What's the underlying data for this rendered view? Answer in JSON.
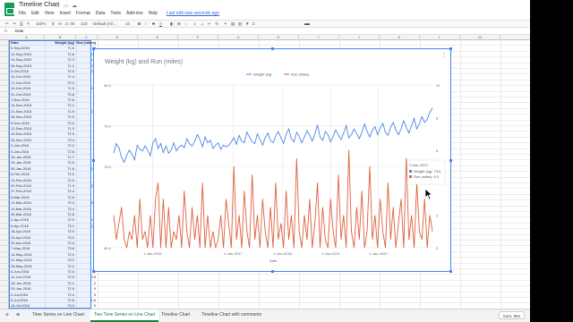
{
  "app": {
    "doc_title": "Timeline Chart",
    "menu": [
      "File",
      "Edit",
      "View",
      "Insert",
      "Format",
      "Data",
      "Tools",
      "Add-ons",
      "Help"
    ],
    "last_edit": "Last edit was seconds ago",
    "fx_label": "fx",
    "fx_value": "Date"
  },
  "toolbar": {
    "zoom": "100%",
    "currency": "$",
    "percent": "%",
    "decimals": ".0 .00",
    "numfmt": "123",
    "font": "Default (Ari...",
    "font_size": "10",
    "bold": "B",
    "italic": "I",
    "strike": "S",
    "text_color": "A"
  },
  "columns": [
    "A",
    "B",
    "C",
    "D",
    "E",
    "F",
    "G",
    "H",
    "I",
    "J",
    "K",
    "L",
    "M"
  ],
  "table": {
    "headers": [
      "Date",
      "Weight (kg)",
      "Run (miles)"
    ],
    "rows": [
      [
        "5-Sep-2015",
        "71.6",
        "2"
      ],
      [
        "12-Sep-2015",
        "72.8",
        "0.5"
      ],
      [
        "19-Sep-2015",
        "72.3",
        "1.5"
      ],
      [
        "26-Sep-2015",
        "71.1",
        "2.5"
      ],
      [
        "3-Oct-2015",
        "70.5",
        "0.5"
      ],
      [
        "10-Oct-2015",
        "71.4",
        "0"
      ],
      [
        "17-Oct-2015",
        "72.0",
        "1"
      ],
      [
        "24-Oct-2015",
        "71.5",
        "0.5"
      ],
      [
        "31-Oct-2015",
        "70.8",
        "2"
      ],
      [
        "7-Nov-2015",
        "72.6",
        "0"
      ],
      [
        "14-Nov-2015",
        "72.1",
        "3"
      ],
      [
        "21-Nov-2015",
        "71.9",
        "0.5"
      ],
      [
        "28-Nov-2015",
        "72.5",
        "1"
      ],
      [
        "5-Dec-2015",
        "72.0",
        "0"
      ],
      [
        "12-Dec-2015",
        "71.3",
        "2"
      ],
      [
        "19-Dec-2015",
        "72.9",
        "0"
      ],
      [
        "26-Dec-2015",
        "73.4",
        "3"
      ],
      [
        "2-Jan-2016",
        "72.2",
        "4"
      ],
      [
        "9-Jan-2016",
        "72.8",
        "0"
      ],
      [
        "16-Jan-2016",
        "71.7",
        "3"
      ],
      [
        "23-Jan-2016",
        "72.5",
        "0"
      ],
      [
        "30-Jan-2016",
        "71.6",
        "2.5"
      ],
      [
        "6-Feb-2016",
        "72.0",
        "0"
      ],
      [
        "13-Feb-2016",
        "72.9",
        "1"
      ],
      [
        "20-Feb-2016",
        "71.9",
        "0.5"
      ],
      [
        "27-Feb-2016",
        "72.4",
        "2"
      ],
      [
        "5-Mar-2016",
        "72.6",
        "0"
      ],
      [
        "12-Mar-2016",
        "72.3",
        "3.5"
      ],
      [
        "19-Mar-2016",
        "73.4",
        "1"
      ],
      [
        "26-Mar-2016",
        "72.8",
        "0"
      ],
      [
        "2-Apr-2016",
        "72.5",
        "2.5"
      ],
      [
        "9-Apr-2016",
        "73.1",
        "0.5"
      ],
      [
        "16-Apr-2016",
        "73.9",
        "2"
      ],
      [
        "23-Apr-2016",
        "73.3",
        "0"
      ],
      [
        "30-Apr-2016",
        "72.4",
        "4"
      ],
      [
        "7-May-2016",
        "73.6",
        "0"
      ],
      [
        "14-May-2016",
        "72.9",
        "2"
      ],
      [
        "21-May-2016",
        "73.2",
        "0"
      ],
      [
        "28-May-2016",
        "72.2",
        "1"
      ],
      [
        "4-Jun-2016",
        "72.6",
        "0"
      ],
      [
        "11-Jun-2016",
        "72.9",
        "0.5"
      ],
      [
        "18-Jun-2016",
        "72.1",
        "2"
      ],
      [
        "25-Jun-2016",
        "72.6",
        "0"
      ],
      [
        "2-Jul-2016",
        "72.4",
        "3"
      ],
      [
        "9-Jul-2016",
        "72.6",
        "1.5"
      ],
      [
        "16-Jul-2016",
        "73.0",
        "0"
      ]
    ]
  },
  "chart": {
    "title": "Weight (kg) and Run (miles)",
    "menu_icon": "kebab-menu-icon",
    "tooltip": {
      "date": "3-Mar-2020",
      "weight_label": "Weight (kg):",
      "weight_value": "75.6",
      "run_label": "Run (miles):",
      "run_value": "0.5"
    }
  },
  "chart_data": {
    "type": "line",
    "title": "Weight (kg) and Run (miles)",
    "xlabel": "Date",
    "ylabel": "",
    "legend_position": "top",
    "grid": true,
    "x_ticks": [
      "1-Jan-2016",
      "1-Jan-2017",
      "1-Jan-2018",
      "1-Jan-2019",
      "1-Jan-2020"
    ],
    "x_range": [
      "5-Sep-2015",
      "1-Sep-2020"
    ],
    "y_left": {
      "ticks": [
        "60.0",
        "70.0",
        "75.0",
        "80.0"
      ],
      "range": [
        60,
        80
      ]
    },
    "y_right": {
      "ticks": [
        "0",
        "2",
        "4",
        "6",
        "8",
        "10"
      ],
      "range": [
        0,
        10
      ]
    },
    "colors": {
      "weight": "#4a86e8",
      "run": "#e06040",
      "selection": "#4285f4",
      "accent": "#188038"
    },
    "series": [
      {
        "name": "Weight (kg)",
        "axis": "left",
        "values": [
          71.6,
          72.8,
          72.3,
          71.1,
          70.5,
          71.4,
          72.0,
          71.5,
          70.8,
          72.6,
          72.1,
          71.9,
          72.5,
          72.0,
          71.3,
          72.9,
          73.4,
          72.2,
          72.8,
          71.7,
          72.5,
          71.6,
          72.0,
          72.9,
          71.9,
          72.4,
          72.6,
          72.3,
          73.4,
          72.8,
          72.5,
          73.1,
          73.9,
          73.3,
          72.4,
          73.6,
          72.9,
          73.2,
          72.2,
          72.6,
          72.9,
          72.1,
          72.6,
          72.4,
          72.6,
          73.0,
          73.5,
          72.7,
          73.8,
          73.1,
          72.9,
          74.2,
          73.6,
          73.0,
          72.8,
          74.0,
          73.3,
          72.6,
          73.5,
          74.1,
          73.2,
          72.9,
          73.7,
          74.3,
          73.5,
          72.8,
          73.9,
          74.6,
          73.4,
          73.0,
          74.2,
          73.7,
          72.9,
          73.6,
          74.4,
          73.8,
          73.1,
          74.0,
          75.1,
          73.6,
          73.2,
          74.3,
          73.9,
          73.0,
          73.7,
          74.5,
          73.8,
          73.3,
          74.1,
          75.0,
          73.5,
          73.9,
          74.6,
          74.0,
          73.4,
          74.2,
          75.2,
          74.3,
          73.6,
          74.4,
          74.9,
          73.9,
          74.7,
          75.3,
          74.2,
          73.8,
          74.8,
          75.4,
          74.5,
          73.9,
          74.6,
          75.6,
          74.8,
          74.1,
          75.0,
          75.9,
          74.6,
          75.2,
          76.1,
          75.4,
          75.8,
          76.6,
          77.2
        ]
      },
      {
        "name": "Run (miles)",
        "axis": "right",
        "values": [
          2,
          0.5,
          1.5,
          2.5,
          0.5,
          0,
          1,
          0.5,
          2,
          0,
          3,
          0.5,
          1,
          0,
          2,
          0,
          3,
          4,
          0,
          3,
          0,
          2.5,
          0,
          1,
          0.5,
          2,
          0,
          3.5,
          1,
          0,
          2.5,
          0.5,
          2,
          0,
          4,
          0,
          2,
          0,
          1,
          0,
          0.5,
          2,
          0,
          3,
          1.5,
          0,
          5,
          0.5,
          2,
          0,
          3.5,
          1,
          0,
          4.5,
          0.5,
          2,
          0,
          3,
          1,
          0,
          2.5,
          0,
          4,
          0.5,
          1.5,
          0,
          3.5,
          0.5,
          2,
          0,
          5.5,
          1,
          0,
          2,
          0.5,
          3,
          0,
          1.5,
          4,
          0,
          2.5,
          0.5,
          0,
          3,
          1,
          0,
          4.5,
          0.5,
          2,
          0,
          6,
          1,
          0,
          2.5,
          0.5,
          3.5,
          0,
          1,
          5,
          0.5,
          2,
          0,
          3,
          1,
          0,
          4,
          0.5,
          2.5,
          0,
          1.5,
          3,
          0,
          5.5,
          0.5,
          2,
          0,
          4,
          1,
          0.5,
          3,
          0,
          2,
          1
        ]
      }
    ]
  },
  "sheets": {
    "tabs": [
      "Time Series on Line Chart",
      "Two Time Series on Line Chart",
      "Timeline Chart",
      "Timeline Chart with comments"
    ],
    "active_index": 1,
    "add_icon": "plus-icon",
    "list_icon": "sheet-list-icon",
    "explore": "Sum: 894"
  }
}
